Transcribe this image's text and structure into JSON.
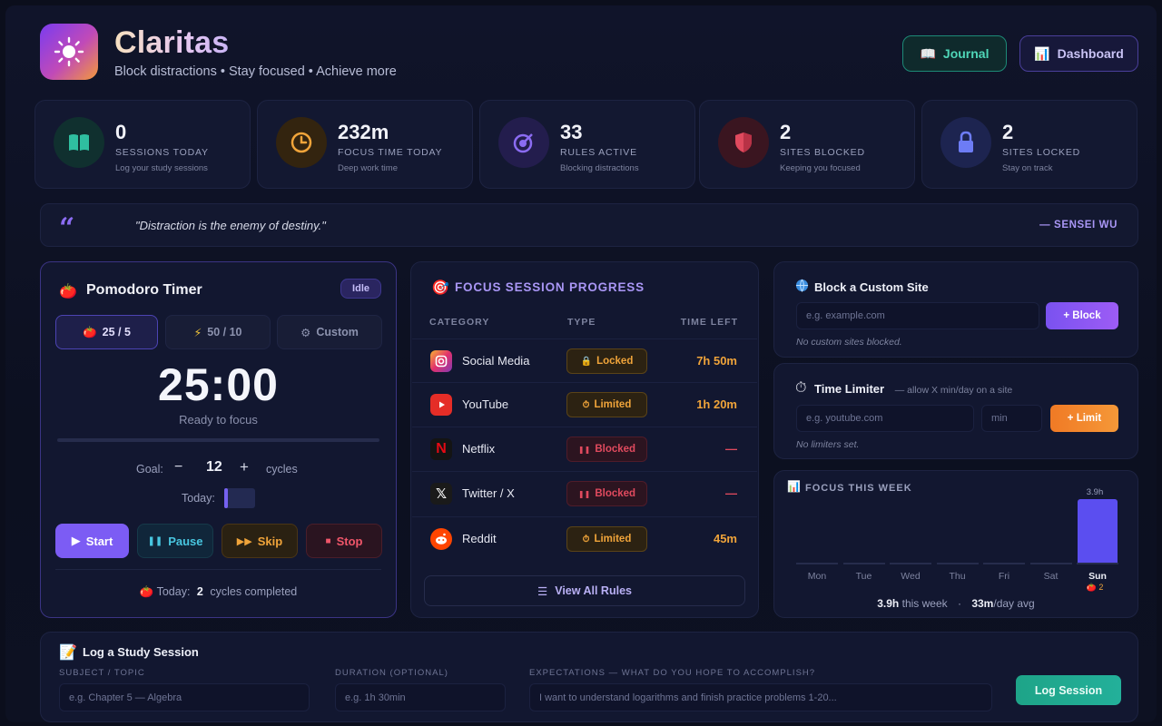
{
  "app": {
    "title": "Claritas",
    "tagline": "Block distractions • Stay focused • Achieve more"
  },
  "header": {
    "journal_label": "Journal",
    "dashboard_label": "Dashboard"
  },
  "stats": [
    {
      "value": "0",
      "label": "SESSIONS TODAY",
      "sub": "Log your study sessions",
      "icon": "book-icon",
      "color": "#2fbfa0"
    },
    {
      "value": "232m",
      "label": "FOCUS TIME TODAY",
      "sub": "Deep work time",
      "icon": "clock-icon",
      "color": "#f0a43a"
    },
    {
      "value": "33",
      "label": "RULES ACTIVE",
      "sub": "Blocking distractions",
      "icon": "target-icon",
      "color": "#8b6cf2"
    },
    {
      "value": "2",
      "label": "SITES BLOCKED",
      "sub": "Keeping you focused",
      "icon": "shield-icon",
      "color": "#e04a5e"
    },
    {
      "value": "2",
      "label": "SITES LOCKED",
      "sub": "Stay on track",
      "icon": "lock-icon",
      "color": "#6d7cf5"
    }
  ],
  "quote": {
    "text": "\"Distraction is the enemy of destiny.\"",
    "author": "— SENSEI WU"
  },
  "pomodoro": {
    "title": "Pomodoro Timer",
    "status": "Idle",
    "tabs": [
      "25 / 5",
      "50 / 10",
      "Custom"
    ],
    "time": "25:00",
    "state_text": "Ready to focus",
    "goal_label": "Goal:",
    "goal_value": "12",
    "goal_unit": "cycles",
    "today_label": "Today:",
    "today_progress": 0,
    "buttons": {
      "start": "Start",
      "pause": "Pause",
      "skip": "Skip",
      "stop": "Stop"
    },
    "completed_prefix": "Today:",
    "completed_count": "2",
    "completed_suffix": "cycles completed"
  },
  "focus_progress": {
    "title": "FOCUS SESSION PROGRESS",
    "columns": [
      "CATEGORY",
      "TYPE",
      "TIME LEFT"
    ],
    "rows": [
      {
        "name": "Social Media",
        "type": "Locked",
        "time_left": "7h 50m",
        "icon": "instagram-icon"
      },
      {
        "name": "YouTube",
        "type": "Limited",
        "time_left": "1h 20m",
        "icon": "youtube-icon"
      },
      {
        "name": "Netflix",
        "type": "Blocked",
        "time_left": "—",
        "icon": "netflix-icon"
      },
      {
        "name": "Twitter / X",
        "type": "Blocked",
        "time_left": "—",
        "icon": "x-icon"
      },
      {
        "name": "Reddit",
        "type": "Limited",
        "time_left": "45m",
        "icon": "reddit-icon"
      }
    ],
    "view_all": "View All Rules"
  },
  "block_site": {
    "title": "Block a Custom Site",
    "placeholder": "e.g. example.com",
    "button": "+ Block",
    "empty": "No custom sites blocked."
  },
  "time_limiter": {
    "title": "Time Limiter",
    "hint": "— allow X min/day on a site",
    "placeholder": "e.g. youtube.com",
    "min_placeholder": "min",
    "button": "+ Limit",
    "empty": "No limiters set."
  },
  "week": {
    "title": "FOCUS THIS WEEK",
    "days": [
      "Mon",
      "Tue",
      "Wed",
      "Thu",
      "Fri",
      "Sat",
      "Sun"
    ],
    "hours": [
      0,
      0,
      0,
      0,
      0,
      0,
      3.9
    ],
    "top_label": "3.9h",
    "sun_note": "🍅 2",
    "total": "3.9h",
    "total_suffix": "this week",
    "avg": "33m",
    "avg_suffix": "/day avg"
  },
  "log": {
    "title": "Log a Study Session",
    "subject_label": "SUBJECT / TOPIC",
    "subject_placeholder": "e.g. Chapter 5 — Algebra",
    "duration_label": "DURATION (OPTIONAL)",
    "duration_placeholder": "e.g. 1h 30min",
    "expect_label": "EXPECTATIONS — WHAT DO YOU HOPE TO ACCOMPLISH?",
    "expect_placeholder": "I want to understand logarithms and finish practice problems 1-20...",
    "button": "Log Session"
  }
}
